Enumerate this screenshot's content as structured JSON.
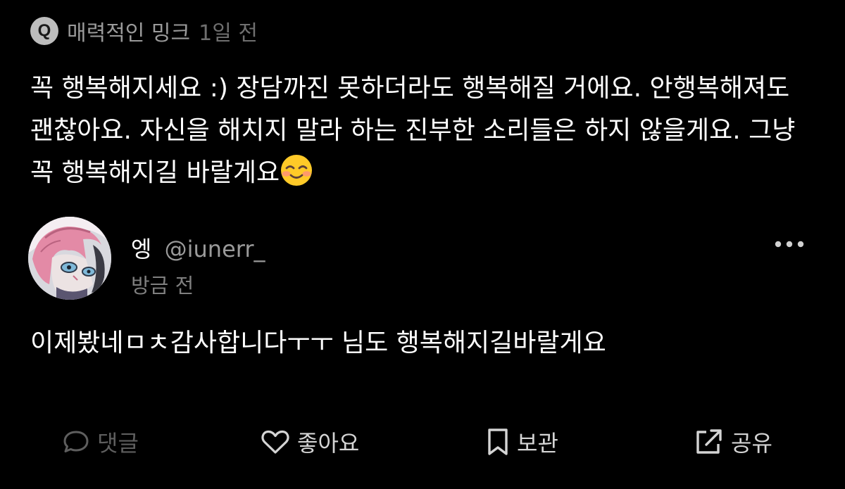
{
  "question": {
    "badge": "Q",
    "author": "매력적인 밍크",
    "time": "1일 전",
    "body": "꼭 행복해지세요 :) 장담까진 못하더라도 행복해질 거에요. 안행복해져도 괜찮아요. 자신을 해치지 말라 하는 진부한 소리들은 하지 않을게요. 그냥 꼭 행복해지길 바랄게요",
    "emoji": "smiling-face-icon"
  },
  "answer": {
    "name": "엥",
    "handle": "@iunerr_",
    "time": "방금 전",
    "body": "이제봤네ㅁㅊ감사합니다ㅜㅜ 님도 행복해지길바랄게요"
  },
  "actions": {
    "comment": "댓글",
    "like": "좋아요",
    "bookmark": "보관",
    "share": "공유"
  },
  "colors": {
    "background": "#000000",
    "text": "#ffffff",
    "muted": "#9a9a9a",
    "disabled": "#5e5e5e"
  }
}
